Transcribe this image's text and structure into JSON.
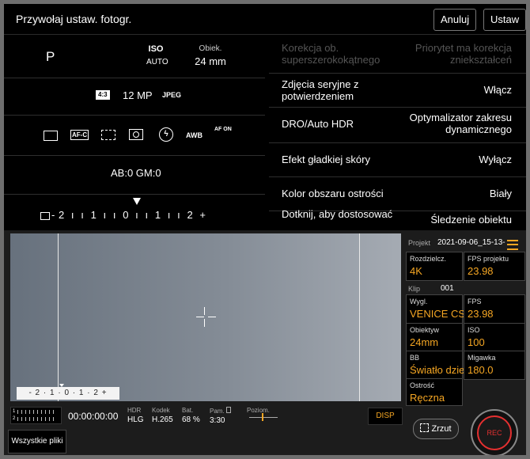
{
  "header": {
    "title": "Przywołaj ustaw. fotogr.",
    "cancel_label": "Anuluj",
    "set_label": "Ustaw"
  },
  "left_panel": {
    "mode": "P",
    "iso_label": "ISO",
    "iso_value": "AUTO",
    "lens_label": "Obiek.",
    "lens_value": "24 mm",
    "aspect": "4:3",
    "megapixels": "12 MP",
    "file_format": "JPEG",
    "icons": [
      "frame-icon",
      "af-c-icon",
      "focus-area-icon",
      "metering-icon",
      "flash-icon",
      "awb-icon",
      "face-af-icon"
    ],
    "icon_texts": {
      "afc": "AF-C",
      "awb": "AWB",
      "face_af": "AF ON"
    },
    "ab_gm": "AB:0   GM:0",
    "ev_scale": "- 2  ı  ı  1  ı  ı  0  ı  ı  1  ı  ı  2  +"
  },
  "settings": [
    {
      "label": "Korekcja ob. superszerokokątnego",
      "value": "Priorytet ma korekcja zniekształceń",
      "disabled": true
    },
    {
      "label": "Zdjęcia seryjne z potwierdzeniem",
      "value": "Włącz",
      "disabled": false
    },
    {
      "label": "DRO/Auto HDR",
      "value": "Optymalizator zakresu dynamicznego",
      "disabled": false
    },
    {
      "label": "Efekt gładkiej skóry",
      "value": "Wyłącz",
      "disabled": false
    },
    {
      "label": "Kolor obszaru ostrości",
      "value": "Biały",
      "disabled": false
    },
    {
      "label": "Dotknij, aby dostosować",
      "value": "Śledzenie obiektu",
      "disabled": false
    }
  ],
  "camera": {
    "viewfinder_scale": "- 2 · 1 · 0 · 1 · 2 +",
    "project_label": "Projekt",
    "project_value": "2021-09-06_15-13-",
    "clip_label": "Klip",
    "clip_value": "001",
    "cells": [
      {
        "label": "Rozdzielcz.",
        "value": "4K"
      },
      {
        "label": "FPS projektu",
        "value": "23.98"
      },
      {
        "label": "Wygl.",
        "value": "VENICE CS"
      },
      {
        "label": "FPS",
        "value": "23.98"
      },
      {
        "label": "Obiektyw",
        "value": "24mm"
      },
      {
        "label": "ISO",
        "value": "100"
      },
      {
        "label": "BB",
        "value": "Światło dzie"
      },
      {
        "label": "Migawka",
        "value": "180.0"
      },
      {
        "label": "Ostrość",
        "value": "Ręczna"
      }
    ],
    "timecode": "00:00:00:00",
    "hdr_label": "HDR",
    "hdr_value": "HLG",
    "codec_label": "Kodek",
    "codec_value": "H.265",
    "battery_label": "Bat.",
    "battery_value": "68 %",
    "storage_label": "Pam.",
    "storage_value": "3:30",
    "level_label": "Poziom.",
    "disp_label": "DISP",
    "files_label": "Wszystkie pliki",
    "zoom_label": "Zrzut",
    "rec_label": "REC"
  },
  "colors": {
    "accent": "#f5a623",
    "rec": "#e53030"
  }
}
